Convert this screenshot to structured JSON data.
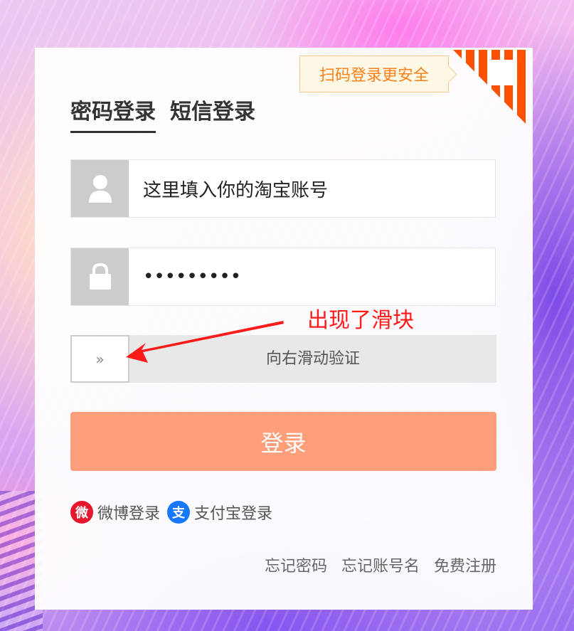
{
  "qr_tip": {
    "text": "扫码登录更安全"
  },
  "tabs": [
    {
      "label": "密码登录",
      "active": true
    },
    {
      "label": "短信登录",
      "active": false
    }
  ],
  "account_field": {
    "value": "这里填入你的淘宝账号",
    "icon": "user-icon"
  },
  "password_field": {
    "value": "•••••••••",
    "icon": "lock-icon"
  },
  "slider": {
    "handle_glyph": "»",
    "text": "向右滑动验证"
  },
  "annotation": {
    "text": "出现了滑块",
    "color": "#ff1a1a"
  },
  "login_button": {
    "label": "登录",
    "color": "#ff9e7a"
  },
  "other_login": [
    {
      "label": "微博登录",
      "icon": "weibo-icon",
      "icon_glyph": "微",
      "color": "#e6162d"
    },
    {
      "label": "支付宝登录",
      "icon": "alipay-icon",
      "icon_glyph": "支",
      "color": "#1677ff"
    }
  ],
  "links": {
    "forgot_password": "忘记密码",
    "forgot_account": "忘记账号名",
    "register": "免费注册"
  },
  "colors": {
    "accent": "#ff5000",
    "tip_text": "#ff7f17"
  }
}
